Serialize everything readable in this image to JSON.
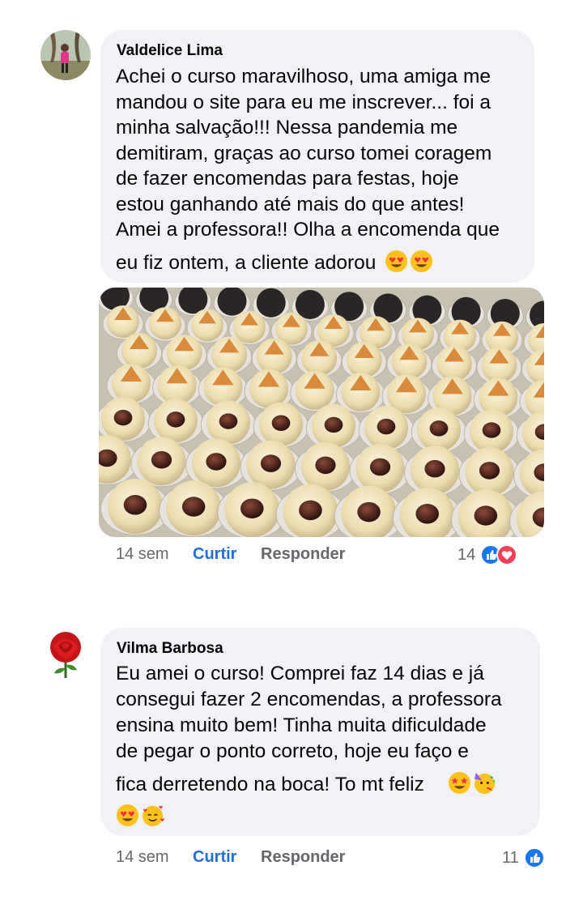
{
  "comments": [
    {
      "author": "Valdelice Lima",
      "lines": [
        "Achei o curso maravilhoso, uma amiga me",
        "mandou o site para eu me inscrever... foi a",
        "minha salvação!!! Nessa pandemia me",
        "demitiram, graças ao curso tomei coragem",
        "de fazer encomendas para festas, hoje",
        "estou ganhando até mais do que antes!",
        "Amei a professora!! Olha a encomenda que",
        "eu fiz ontem, a cliente adorou"
      ],
      "trailing_emojis": [
        "heart-eyes-emoji",
        "heart-eyes-emoji"
      ],
      "time": "14 sem",
      "like_label": "Curtir",
      "reply_label": "Responder",
      "reaction_count": "14",
      "reactions": [
        "like",
        "love"
      ],
      "colors": {
        "like": "#1877f2",
        "love": "#f33e58"
      }
    },
    {
      "author": "Vilma Barbosa",
      "lines": [
        "Eu amei o curso! Comprei faz 14 dias e já",
        "consegui fazer 2 encomendas, a professora",
        "ensina muito bem! Tinha muita dificuldade",
        "de pegar o ponto correto, hoje eu faço e",
        "fica derretendo na boca! To mt feliz"
      ],
      "line_emojis": [
        "star-struck-emoji",
        "partying-face-emoji"
      ],
      "trailing_emojis": [
        "heart-eyes-emoji",
        "smiling-hearts-emoji"
      ],
      "time": "14 sem",
      "like_label": "Curtir",
      "reply_label": "Responder",
      "reaction_count": "11",
      "reactions": [
        "like"
      ],
      "colors": {
        "like": "#1877f2"
      }
    }
  ],
  "theme": {
    "bubble": "#f0f2f5",
    "action_text": "#65676b",
    "curtir_blue": "#216fdb"
  }
}
